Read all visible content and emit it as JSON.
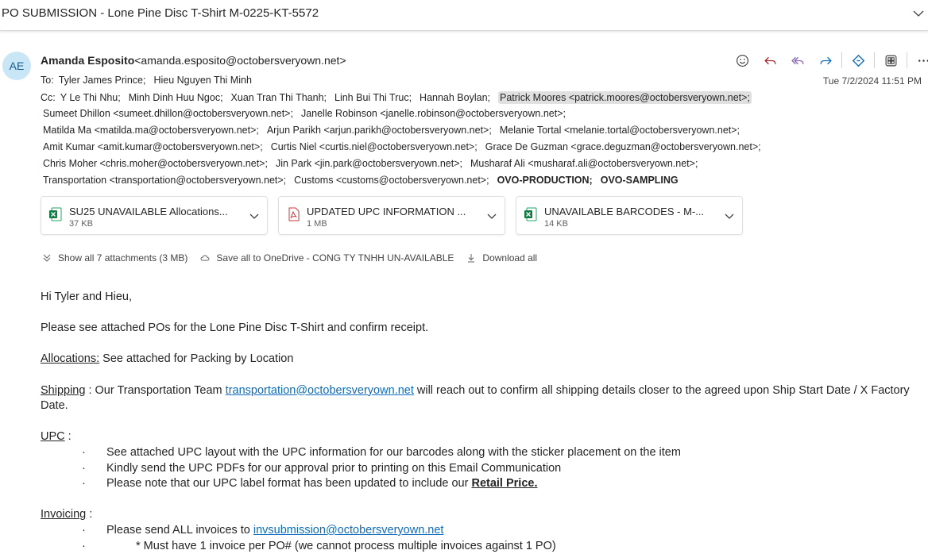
{
  "subject": "PO SUBMISSION - Lone Pine Disc T-Shirt M-0225-KT-5572",
  "sender": {
    "initials": "AE",
    "name": "Amanda Esposito",
    "email": "<amanda.esposito@octobersveryown.net>",
    "date": "Tue 7/2/2024 11:51 PM"
  },
  "actions": [
    "emoji-icon",
    "reply-icon",
    "reply-all-icon",
    "forward-icon",
    "loop-icon",
    "apps-icon",
    "more-icon"
  ],
  "to_label": "To:",
  "to": [
    "Tyler James Prince;",
    "Hieu Nguyen Thi Minh"
  ],
  "cc_label": "Cc:",
  "cc_line1": [
    "Y Le Thi Nhu;",
    "Minh Dinh Huu Ngoc;",
    "Xuan Tran Thi Thanh;",
    "Linh Bui Thi Truc;",
    "Hannah Boylan;",
    "Patrick Moores <patrick.moores@octobersveryown.net>;"
  ],
  "cc_line2": [
    "Sumeet Dhillon <sumeet.dhillon@octobersveryown.net>;",
    "Janelle Robinson <janelle.robinson@octobersveryown.net>;"
  ],
  "cc_line3": [
    "Matilda Ma <matilda.ma@octobersveryown.net>;",
    "Arjun Parikh <arjun.parikh@octobersveryown.net>;",
    "Melanie Tortal <melanie.tortal@octobersveryown.net>;"
  ],
  "cc_line4": [
    "Amit Kumar <amit.kumar@octobersveryown.net>;",
    "Curtis Niel <curtis.niel@octobersveryown.net>;",
    "Grace De Guzman <grace.deguzman@octobersveryown.net>;"
  ],
  "cc_line5": [
    "Chris Moher <chris.moher@octobersveryown.net>;",
    "Jin Park <jin.park@octobersveryown.net>;",
    "Musharaf Ali <musharaf.ali@octobersveryown.net>;"
  ],
  "cc_line6": [
    "Transportation <transportation@octobersveryown.net>;",
    "Customs <customs@octobersveryown.net>;",
    "OVO-PRODUCTION;",
    "OVO-SAMPLING"
  ],
  "attachments": [
    {
      "name": "SU25 UNAVAILABLE Allocations...",
      "size": "37 KB",
      "type": "excel"
    },
    {
      "name": "UPDATED UPC INFORMATION ...",
      "size": "1 MB",
      "type": "pdf"
    },
    {
      "name": "UNAVAILABLE BARCODES - M-...",
      "size": "14 KB",
      "type": "excel"
    }
  ],
  "attachment_bar": {
    "show_all": "Show all 7 attachments (3 MB)",
    "save_onedrive": "Save all to OneDrive - CONG TY TNHH UN-AVAILABLE",
    "download_all": "Download all"
  },
  "body": {
    "greeting": "Hi Tyler and Hieu,",
    "intro": "Please see attached POs for the Lone Pine Disc T-Shirt and confirm receipt.",
    "allocations_label": "Allocations:",
    "allocations_text": " See attached for Packing by Location",
    "shipping_label": "Shipping",
    "shipping_pre": " : Our Transportation Team ",
    "shipping_link": "transportation@octobersveryown.net",
    "shipping_post": " will reach out to confirm all shipping details closer to the agreed upon Ship Start Date / X Factory Date.",
    "upc_label": "UPC",
    "upc_colon": " :",
    "upc_b1": "See attached UPC layout with the UPC information for our barcodes along with the sticker placement on the item",
    "upc_b2": "Kindly send the UPC PDFs for our approval prior to printing on this Email Communication",
    "upc_b3_pre": "Please note that our UPC label format has been updated to include our ",
    "upc_b3_bold": "Retail Price.",
    "invoicing_label": "Invoicing",
    "invoicing_colon": " :",
    "inv_b1_pre": "Please send ALL invoices to ",
    "inv_b1_link": "invsubmission@octobersveryown.net",
    "inv_sub": "* Must have 1 invoice per PO# (we cannot process multiple invoices against 1 PO)",
    "bullet": "·"
  }
}
